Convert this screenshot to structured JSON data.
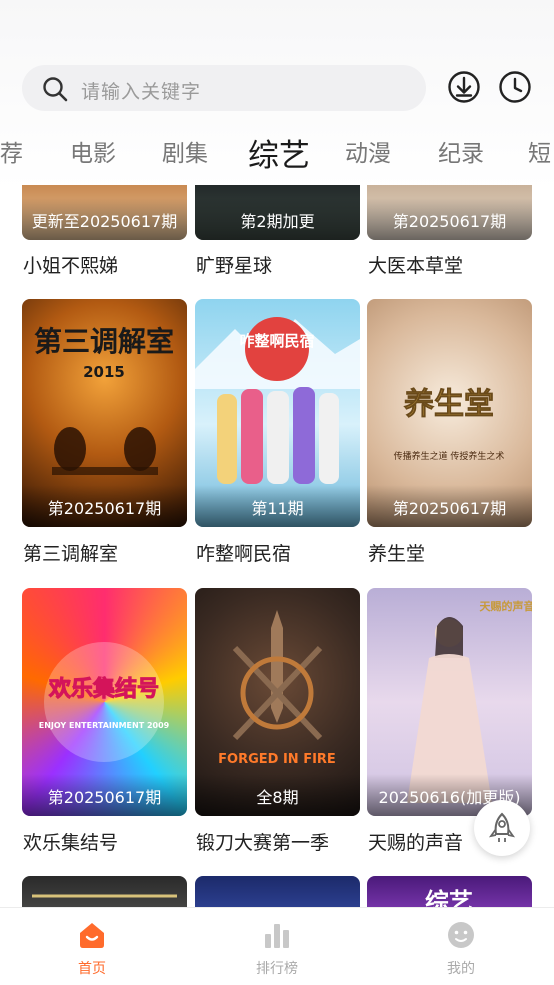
{
  "search": {
    "placeholder": "请输入关键字"
  },
  "header_icons": [
    "download-icon",
    "history-icon"
  ],
  "tabs": [
    {
      "label": "荐"
    },
    {
      "label": "电影"
    },
    {
      "label": "剧集"
    },
    {
      "label": "综艺"
    },
    {
      "label": "动漫"
    },
    {
      "label": "纪录"
    },
    {
      "label": "短"
    }
  ],
  "active_tab": "综艺",
  "cards": [
    {
      "title": "小姐不熙娣",
      "badge": "更新至20250617期"
    },
    {
      "title": "旷野星球",
      "badge": "第2期加更"
    },
    {
      "title": "大医本草堂",
      "badge": "第20250617期"
    },
    {
      "title": "第三调解室",
      "badge": "第20250617期",
      "poster_text": "第三调解室",
      "poster_sub": "2015"
    },
    {
      "title": "咋整啊民宿",
      "badge": "第11期",
      "poster_text": "咋整啊民宿"
    },
    {
      "title": "养生堂",
      "badge": "第20250617期",
      "poster_text": "养生堂",
      "poster_sub": "传播养生之道 传授养生之术"
    },
    {
      "title": "欢乐集结号",
      "badge": "第20250617期",
      "poster_text": "欢乐集结号",
      "poster_sub": "ENJOY ENTERTAINMENT 2009"
    },
    {
      "title": "锻刀大赛第一季",
      "badge": "全8期",
      "poster_text": "FORGED IN FIRE"
    },
    {
      "title": "天赐的声音",
      "badge": "20250616(加更版)",
      "poster_text": "天赐的声音"
    },
    {
      "title": "",
      "badge": ""
    },
    {
      "title": "",
      "badge": ""
    },
    {
      "title": "",
      "badge": "",
      "poster_text": "综艺"
    }
  ],
  "float_button": {
    "icon": "rocket-icon"
  },
  "bottom_nav": [
    {
      "label": "首页",
      "icon": "home-icon",
      "active": true
    },
    {
      "label": "排行榜",
      "icon": "ranking-icon",
      "active": false
    },
    {
      "label": "我的",
      "icon": "profile-icon",
      "active": false
    }
  ],
  "colors": {
    "accent": "#ff6b2c",
    "inactive": "#aaaaaa"
  }
}
